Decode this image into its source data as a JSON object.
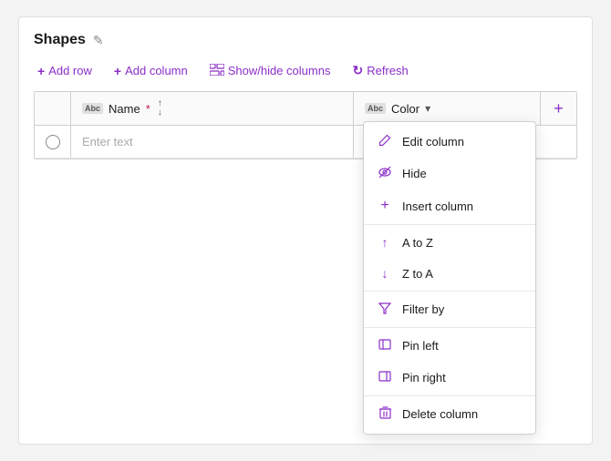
{
  "panel": {
    "title": "Shapes",
    "edit_icon": "✎"
  },
  "toolbar": {
    "add_row_label": "Add row",
    "add_column_label": "Add column",
    "show_hide_label": "Show/hide columns",
    "refresh_label": "Refresh"
  },
  "grid": {
    "columns": [
      {
        "id": "name",
        "label": "Name",
        "required": true
      },
      {
        "id": "color",
        "label": "Color"
      }
    ],
    "add_button_label": "+",
    "row_placeholder": "Enter text"
  },
  "dropdown": {
    "items": [
      {
        "id": "edit-column",
        "label": "Edit column",
        "icon": "✏"
      },
      {
        "id": "hide",
        "label": "Hide",
        "icon": "👁"
      },
      {
        "id": "insert-column",
        "label": "Insert column",
        "icon": "+"
      },
      {
        "id": "separator1"
      },
      {
        "id": "a-to-z",
        "label": "A to Z",
        "icon": "↑"
      },
      {
        "id": "z-to-a",
        "label": "Z to A",
        "icon": "↓"
      },
      {
        "id": "separator2"
      },
      {
        "id": "filter-by",
        "label": "Filter by",
        "icon": "⊽"
      },
      {
        "id": "separator3"
      },
      {
        "id": "pin-left",
        "label": "Pin left",
        "icon": "▤"
      },
      {
        "id": "pin-right",
        "label": "Pin right",
        "icon": "▤"
      },
      {
        "id": "separator4"
      },
      {
        "id": "delete-column",
        "label": "Delete column",
        "icon": "🗑"
      }
    ]
  }
}
